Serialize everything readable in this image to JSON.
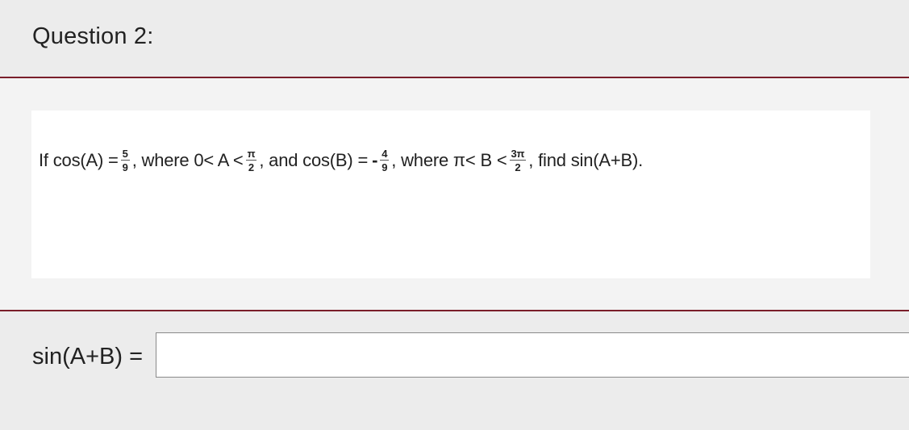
{
  "question": {
    "title": "Question 2:"
  },
  "problem": {
    "if_cos_a": "If cos(A) =",
    "frac_a": {
      "num": "5",
      "den": "9"
    },
    "where_a": ", where 0< A <",
    "frac_a_bound": {
      "num": "π",
      "den": "2"
    },
    "and_cos_b": ", and cos(B) =",
    "neg_sign": "-",
    "frac_b": {
      "num": "4",
      "den": "9"
    },
    "where_b": ", where π< B <",
    "frac_b_bound": {
      "num": "3π",
      "den": "2"
    },
    "find": ", find sin(A+B)."
  },
  "answer": {
    "label": "sin(A+B) =",
    "value": "",
    "placeholder": ""
  },
  "colors": {
    "divider": "#7a1e2a",
    "background": "#ececec",
    "panel": "#f3f3f3",
    "box": "#ffffff"
  }
}
